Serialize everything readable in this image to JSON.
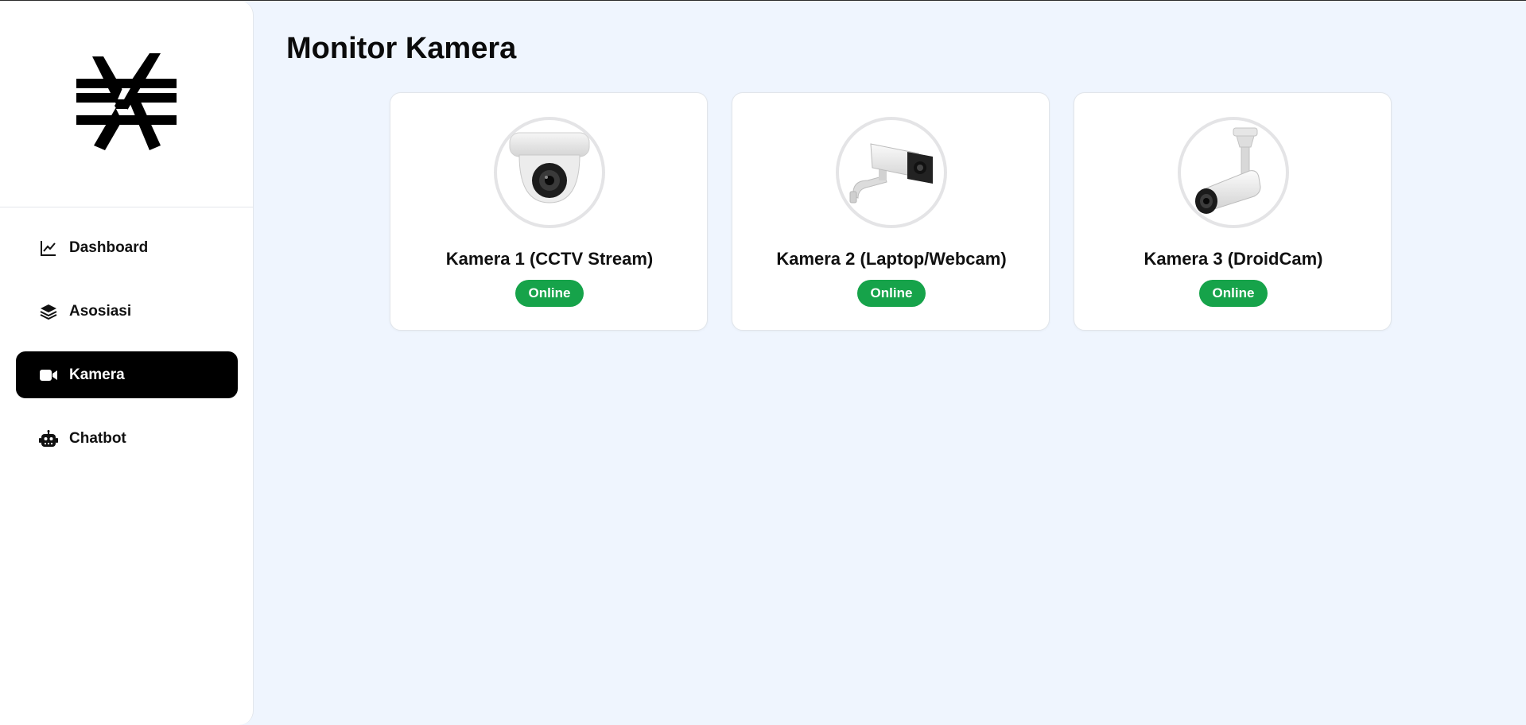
{
  "sidebar": {
    "logo": "app-logo",
    "items": [
      {
        "label": "Dashboard",
        "icon": "chart-line-icon",
        "active": false
      },
      {
        "label": "Asosiasi",
        "icon": "layers-icon",
        "active": false
      },
      {
        "label": "Kamera",
        "icon": "video-camera-icon",
        "active": true
      },
      {
        "label": "Chatbot",
        "icon": "robot-icon",
        "active": false
      }
    ]
  },
  "main": {
    "title": "Monitor Kamera",
    "cameras": [
      {
        "name": "Kamera 1 (CCTV Stream)",
        "status": "Online",
        "image": "dome-camera-image"
      },
      {
        "name": "Kamera 2 (Laptop/Webcam)",
        "status": "Online",
        "image": "box-camera-image"
      },
      {
        "name": "Kamera 3 (DroidCam)",
        "status": "Online",
        "image": "bullet-camera-image"
      }
    ]
  },
  "colors": {
    "background": "#eff5fe",
    "active_nav": "#000000",
    "status_online": "#16a34a"
  }
}
